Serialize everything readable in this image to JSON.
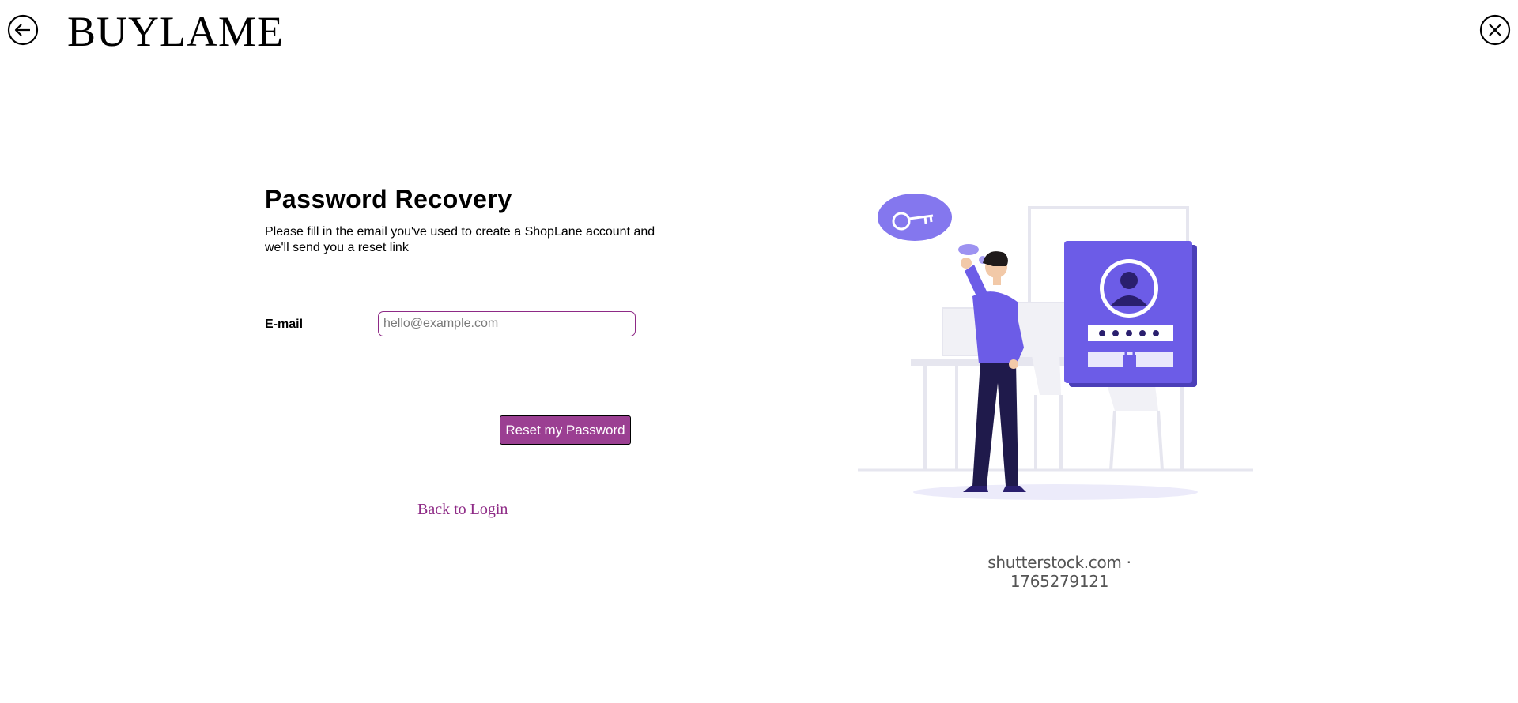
{
  "header": {
    "brand": "BUYLAME",
    "back_icon": "arrow-left-circle-icon",
    "close_icon": "close-circle-icon"
  },
  "form": {
    "title": "Password Recovery",
    "subtitle": "Please fill in the email you've used to create a ShopLane account and we'll send you a reset link",
    "email_label": "E-mail",
    "email_value": "",
    "email_placeholder": "hello@example.com",
    "reset_button": "Reset my Password",
    "back_to_login": "Back to Login"
  },
  "illustration": {
    "watermark": "shutterstock.com · 1765279121",
    "password_dots": "•••••"
  },
  "colors": {
    "accent": "#9b3f92",
    "illustration_purple": "#6c5ce7"
  }
}
